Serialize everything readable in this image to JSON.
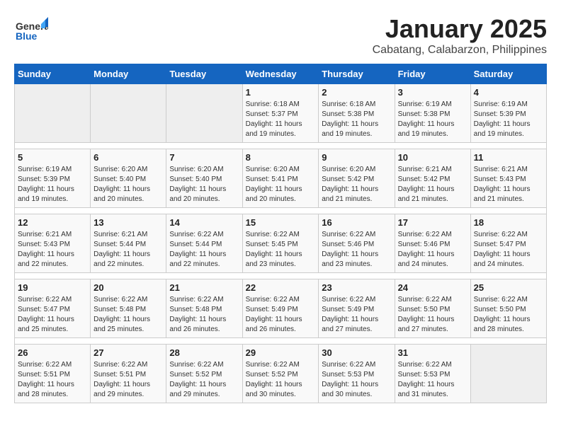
{
  "header": {
    "logo_general": "General",
    "logo_blue": "Blue",
    "title": "January 2025",
    "subtitle": "Cabatang, Calabarzon, Philippines"
  },
  "days_of_week": [
    "Sunday",
    "Monday",
    "Tuesday",
    "Wednesday",
    "Thursday",
    "Friday",
    "Saturday"
  ],
  "weeks": [
    [
      {
        "day": "",
        "info": ""
      },
      {
        "day": "",
        "info": ""
      },
      {
        "day": "",
        "info": ""
      },
      {
        "day": "1",
        "info": "Sunrise: 6:18 AM\nSunset: 5:37 PM\nDaylight: 11 hours\nand 19 minutes."
      },
      {
        "day": "2",
        "info": "Sunrise: 6:18 AM\nSunset: 5:38 PM\nDaylight: 11 hours\nand 19 minutes."
      },
      {
        "day": "3",
        "info": "Sunrise: 6:19 AM\nSunset: 5:38 PM\nDaylight: 11 hours\nand 19 minutes."
      },
      {
        "day": "4",
        "info": "Sunrise: 6:19 AM\nSunset: 5:39 PM\nDaylight: 11 hours\nand 19 minutes."
      }
    ],
    [
      {
        "day": "5",
        "info": "Sunrise: 6:19 AM\nSunset: 5:39 PM\nDaylight: 11 hours\nand 19 minutes."
      },
      {
        "day": "6",
        "info": "Sunrise: 6:20 AM\nSunset: 5:40 PM\nDaylight: 11 hours\nand 20 minutes."
      },
      {
        "day": "7",
        "info": "Sunrise: 6:20 AM\nSunset: 5:40 PM\nDaylight: 11 hours\nand 20 minutes."
      },
      {
        "day": "8",
        "info": "Sunrise: 6:20 AM\nSunset: 5:41 PM\nDaylight: 11 hours\nand 20 minutes."
      },
      {
        "day": "9",
        "info": "Sunrise: 6:20 AM\nSunset: 5:42 PM\nDaylight: 11 hours\nand 21 minutes."
      },
      {
        "day": "10",
        "info": "Sunrise: 6:21 AM\nSunset: 5:42 PM\nDaylight: 11 hours\nand 21 minutes."
      },
      {
        "day": "11",
        "info": "Sunrise: 6:21 AM\nSunset: 5:43 PM\nDaylight: 11 hours\nand 21 minutes."
      }
    ],
    [
      {
        "day": "12",
        "info": "Sunrise: 6:21 AM\nSunset: 5:43 PM\nDaylight: 11 hours\nand 22 minutes."
      },
      {
        "day": "13",
        "info": "Sunrise: 6:21 AM\nSunset: 5:44 PM\nDaylight: 11 hours\nand 22 minutes."
      },
      {
        "day": "14",
        "info": "Sunrise: 6:22 AM\nSunset: 5:44 PM\nDaylight: 11 hours\nand 22 minutes."
      },
      {
        "day": "15",
        "info": "Sunrise: 6:22 AM\nSunset: 5:45 PM\nDaylight: 11 hours\nand 23 minutes."
      },
      {
        "day": "16",
        "info": "Sunrise: 6:22 AM\nSunset: 5:46 PM\nDaylight: 11 hours\nand 23 minutes."
      },
      {
        "day": "17",
        "info": "Sunrise: 6:22 AM\nSunset: 5:46 PM\nDaylight: 11 hours\nand 24 minutes."
      },
      {
        "day": "18",
        "info": "Sunrise: 6:22 AM\nSunset: 5:47 PM\nDaylight: 11 hours\nand 24 minutes."
      }
    ],
    [
      {
        "day": "19",
        "info": "Sunrise: 6:22 AM\nSunset: 5:47 PM\nDaylight: 11 hours\nand 25 minutes."
      },
      {
        "day": "20",
        "info": "Sunrise: 6:22 AM\nSunset: 5:48 PM\nDaylight: 11 hours\nand 25 minutes."
      },
      {
        "day": "21",
        "info": "Sunrise: 6:22 AM\nSunset: 5:48 PM\nDaylight: 11 hours\nand 26 minutes."
      },
      {
        "day": "22",
        "info": "Sunrise: 6:22 AM\nSunset: 5:49 PM\nDaylight: 11 hours\nand 26 minutes."
      },
      {
        "day": "23",
        "info": "Sunrise: 6:22 AM\nSunset: 5:49 PM\nDaylight: 11 hours\nand 27 minutes."
      },
      {
        "day": "24",
        "info": "Sunrise: 6:22 AM\nSunset: 5:50 PM\nDaylight: 11 hours\nand 27 minutes."
      },
      {
        "day": "25",
        "info": "Sunrise: 6:22 AM\nSunset: 5:50 PM\nDaylight: 11 hours\nand 28 minutes."
      }
    ],
    [
      {
        "day": "26",
        "info": "Sunrise: 6:22 AM\nSunset: 5:51 PM\nDaylight: 11 hours\nand 28 minutes."
      },
      {
        "day": "27",
        "info": "Sunrise: 6:22 AM\nSunset: 5:51 PM\nDaylight: 11 hours\nand 29 minutes."
      },
      {
        "day": "28",
        "info": "Sunrise: 6:22 AM\nSunset: 5:52 PM\nDaylight: 11 hours\nand 29 minutes."
      },
      {
        "day": "29",
        "info": "Sunrise: 6:22 AM\nSunset: 5:52 PM\nDaylight: 11 hours\nand 30 minutes."
      },
      {
        "day": "30",
        "info": "Sunrise: 6:22 AM\nSunset: 5:53 PM\nDaylight: 11 hours\nand 30 minutes."
      },
      {
        "day": "31",
        "info": "Sunrise: 6:22 AM\nSunset: 5:53 PM\nDaylight: 11 hours\nand 31 minutes."
      },
      {
        "day": "",
        "info": ""
      }
    ]
  ]
}
